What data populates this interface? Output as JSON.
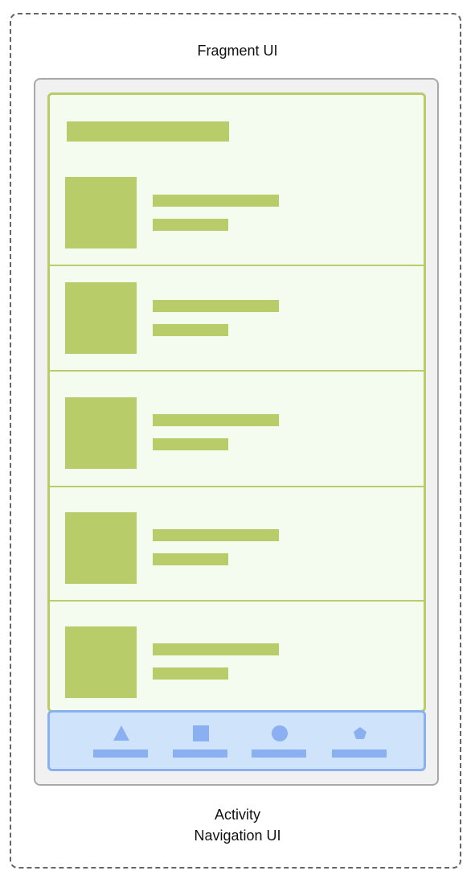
{
  "labels": {
    "top": "Fragment UI",
    "bottom_line1": "Activity",
    "bottom_line2": "Navigation UI"
  },
  "colors": {
    "fragment_fill": "#f3fcef",
    "fragment_accent": "#b8cc6a",
    "nav_fill": "#cfe4fb",
    "nav_accent": "#8ab0f2",
    "device_fill": "#f1f1f1",
    "device_border": "#a8a8a8"
  },
  "list_rows": [
    {
      "id": "row-1"
    },
    {
      "id": "row-2"
    },
    {
      "id": "row-3"
    },
    {
      "id": "row-4"
    },
    {
      "id": "row-5"
    }
  ],
  "nav_items": [
    {
      "icon": "triangle-icon"
    },
    {
      "icon": "square-icon"
    },
    {
      "icon": "circle-icon"
    },
    {
      "icon": "pentagon-icon"
    }
  ]
}
